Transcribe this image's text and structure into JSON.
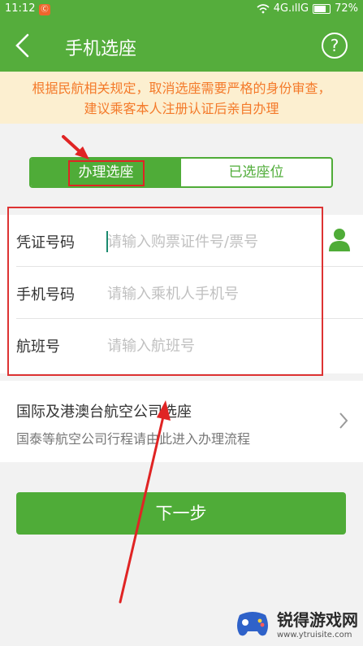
{
  "status": {
    "time": "11:12",
    "notif": "Ⓒ",
    "signal": "4G.ıllG",
    "battery": "72%"
  },
  "header": {
    "title": "手机选座",
    "help": "?"
  },
  "notice": {
    "line1": "根据民航相关规定，取消选座需要严格的身份审查，",
    "line2": "建议乘客本人注册认证后亲自办理"
  },
  "tabs": {
    "active": "办理选座",
    "inactive": "已选座位"
  },
  "form": {
    "voucher": {
      "label": "凭证号码",
      "placeholder": "请输入购票证件号/票号"
    },
    "phone": {
      "label": "手机号码",
      "placeholder": "请输入乘机人手机号"
    },
    "flight": {
      "label": "航班号",
      "placeholder": "请输入航班号"
    }
  },
  "intl": {
    "title": "国际及港澳台航空公司选座",
    "subtitle": "国泰等航空公司行程请由此进入办理流程"
  },
  "next": {
    "label": "下一步"
  },
  "watermark": {
    "name": "锐得游戏网",
    "url": "www.ytruisite.com"
  },
  "colors": {
    "green": "#55ad3c",
    "annotation": "#e02424",
    "notice": "#f47a2a"
  }
}
